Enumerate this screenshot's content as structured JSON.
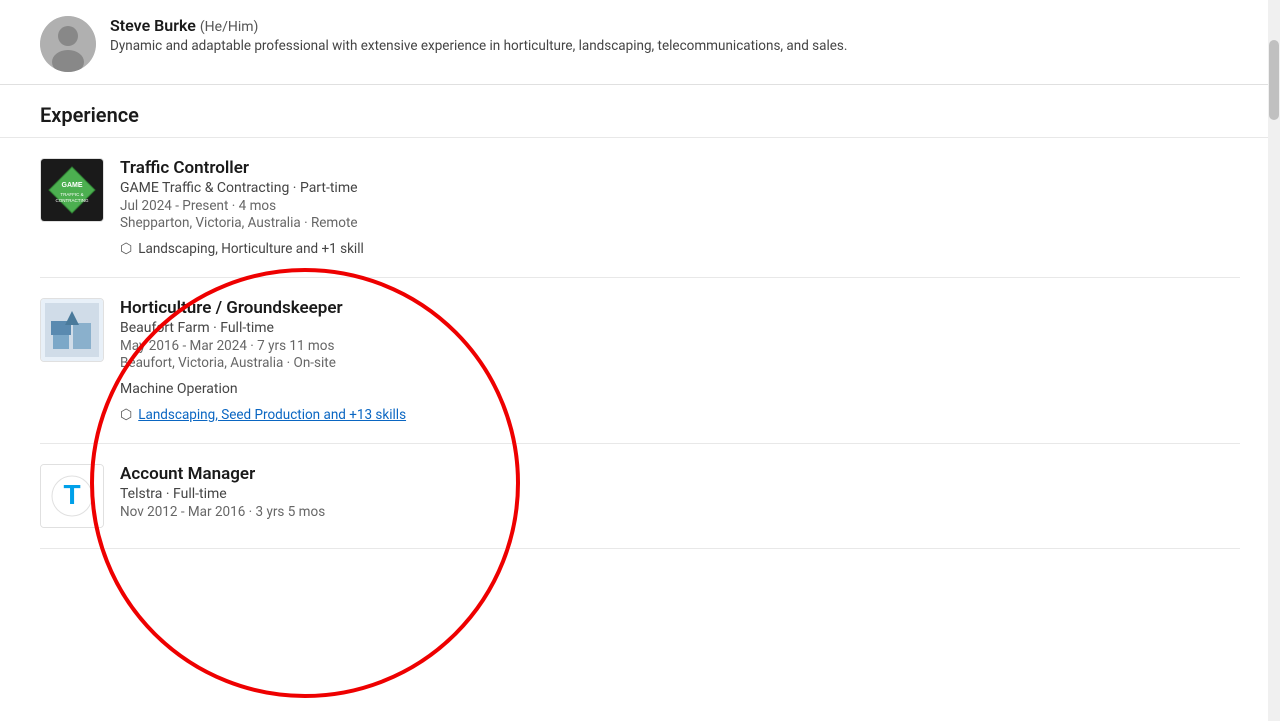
{
  "profile": {
    "name": "Steve Burke",
    "pronouns": "(He/Him)",
    "bio": "Dynamic and adaptable professional with extensive experience in horticulture, landscaping, telecommunications, and sales."
  },
  "section": {
    "heading": "Experience"
  },
  "experiences": [
    {
      "id": "traffic-controller",
      "job_title": "Traffic Controller",
      "company": "GAME Traffic & Contracting",
      "employment_type": "Part-time",
      "dates": "Jul 2024 - Present · 4 mos",
      "location": "Shepparton, Victoria, Australia · Remote",
      "skills_text": "Landscaping, Horticulture and +1 skill",
      "skills_link": false,
      "machine_op": "",
      "logo_type": "game"
    },
    {
      "id": "horticulture-groundskeeper",
      "job_title": "Horticulture / Groundskeeper",
      "company": "Beaufort Farm",
      "employment_type": "Full-time",
      "dates": "May 2016 - Mar 2024 · 7 yrs 11 mos",
      "location": "Beaufort, Victoria, Australia · On-site",
      "skills_text": "Landscaping, Seed Production and +13 skills",
      "skills_link": true,
      "machine_op": "Machine Operation",
      "logo_type": "beaufort"
    },
    {
      "id": "account-manager",
      "job_title": "Account Manager",
      "company": "Telstra",
      "employment_type": "Full-time",
      "dates": "Nov 2012 - Mar 2016 · 3 yrs 5 mos",
      "location": "",
      "skills_text": "",
      "skills_link": false,
      "machine_op": "",
      "logo_type": "telstra"
    }
  ],
  "icons": {
    "diamond": "⬡"
  }
}
